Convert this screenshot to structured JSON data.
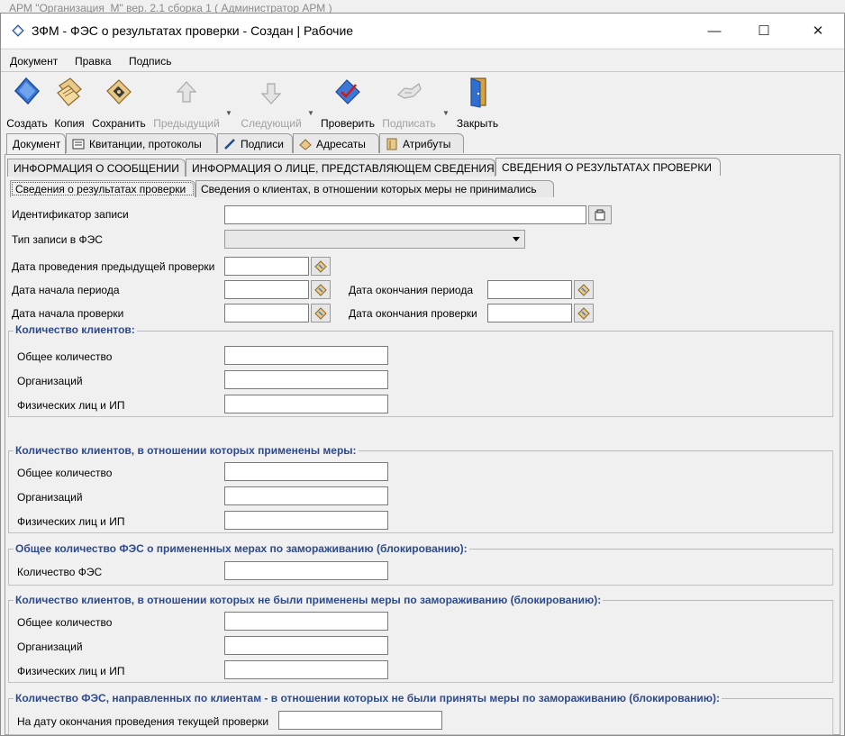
{
  "background_window_title": "АРМ \"Организация_М\" вер. 2.1 сборка 1 ( Администратор АРМ )",
  "window": {
    "title": "ЗФМ - ФЭС о результатах проверки - Создан | Рабочие",
    "controls": {
      "minimize": "—",
      "maximize": "☐",
      "close": "✕"
    }
  },
  "menu": [
    "Документ",
    "Правка",
    "Подпись"
  ],
  "toolbar": [
    {
      "label": "Создать",
      "icon": "create-icon",
      "enabled": true
    },
    {
      "label": "Копия",
      "icon": "copy-icon",
      "enabled": true
    },
    {
      "label": "Сохранить",
      "icon": "save-icon",
      "enabled": true
    },
    {
      "label": "Предыдущий",
      "icon": "arrow-up-icon",
      "enabled": false
    },
    {
      "label": "Следующий",
      "icon": "arrow-down-icon",
      "enabled": false
    },
    {
      "label": "Проверить",
      "icon": "check-icon",
      "enabled": true
    },
    {
      "label": "Подписать",
      "icon": "sign-icon",
      "enabled": false
    },
    {
      "label": "Закрыть",
      "icon": "door-close-icon",
      "enabled": true
    }
  ],
  "main_tabs": [
    {
      "label": "Документ",
      "active": true
    },
    {
      "label": "Квитанции, протоколы",
      "icon": "receipts-icon"
    },
    {
      "label": "Подписи",
      "icon": "pen-icon"
    },
    {
      "label": "Адресаты",
      "icon": "address-icon"
    },
    {
      "label": "Атрибуты",
      "icon": "attributes-icon"
    }
  ],
  "section_tabs": [
    {
      "label": "ИНФОРМАЦИЯ О СООБЩЕНИИ"
    },
    {
      "label": "ИНФОРМАЦИЯ О ЛИЦЕ, ПРЕДСТАВЛЯЮЩЕМ СВЕДЕНИЯ"
    },
    {
      "label": "СВЕДЕНИЯ О РЕЗУЛЬТАТАХ ПРОВЕРКИ",
      "active": true
    }
  ],
  "sub_tabs": [
    {
      "label": "Сведения о результатах проверки",
      "active": true
    },
    {
      "label": "Сведения о клиентах, в отношении которых меры не принимались"
    }
  ],
  "form": {
    "record_id_label": "Идентификатор записи",
    "record_id_value": "",
    "record_type_label": "Тип записи в ФЭС",
    "record_type_value": "",
    "prev_check_date_label": "Дата проведения предыдущей проверки",
    "period_start_label": "Дата начала периода",
    "period_end_label": "Дата окончания периода",
    "check_start_label": "Дата начала проверки",
    "check_end_label": "Дата окончания проверки"
  },
  "groups": {
    "clients": {
      "title": "Количество клиентов:",
      "fields": [
        "Общее количество",
        "Организаций",
        "Физических лиц и ИП"
      ]
    },
    "clients_measures_applied": {
      "title": "Количество клиентов, в отношении которых применены меры:",
      "fields": [
        "Общее количество",
        "Организаций",
        "Физических лиц и ИП"
      ]
    },
    "fes_freezing": {
      "title": "Общее количество ФЭС о примененных мерах по замораживанию (блокированию):",
      "fields": [
        "Количество ФЭС"
      ]
    },
    "clients_not_applied": {
      "title": "Количество клиентов, в отношении которых не были применены меры по замораживанию (блокированию):",
      "fields": [
        "Общее количество",
        "Организаций",
        "Физических лиц и ИП"
      ]
    },
    "fes_sent": {
      "title": "Количество ФЭС, направленных по клиентам - в отношении которых не были приняты меры по замораживанию (блокированию):",
      "fields": [
        "На дату окончания проведения текущей проверки"
      ]
    }
  }
}
